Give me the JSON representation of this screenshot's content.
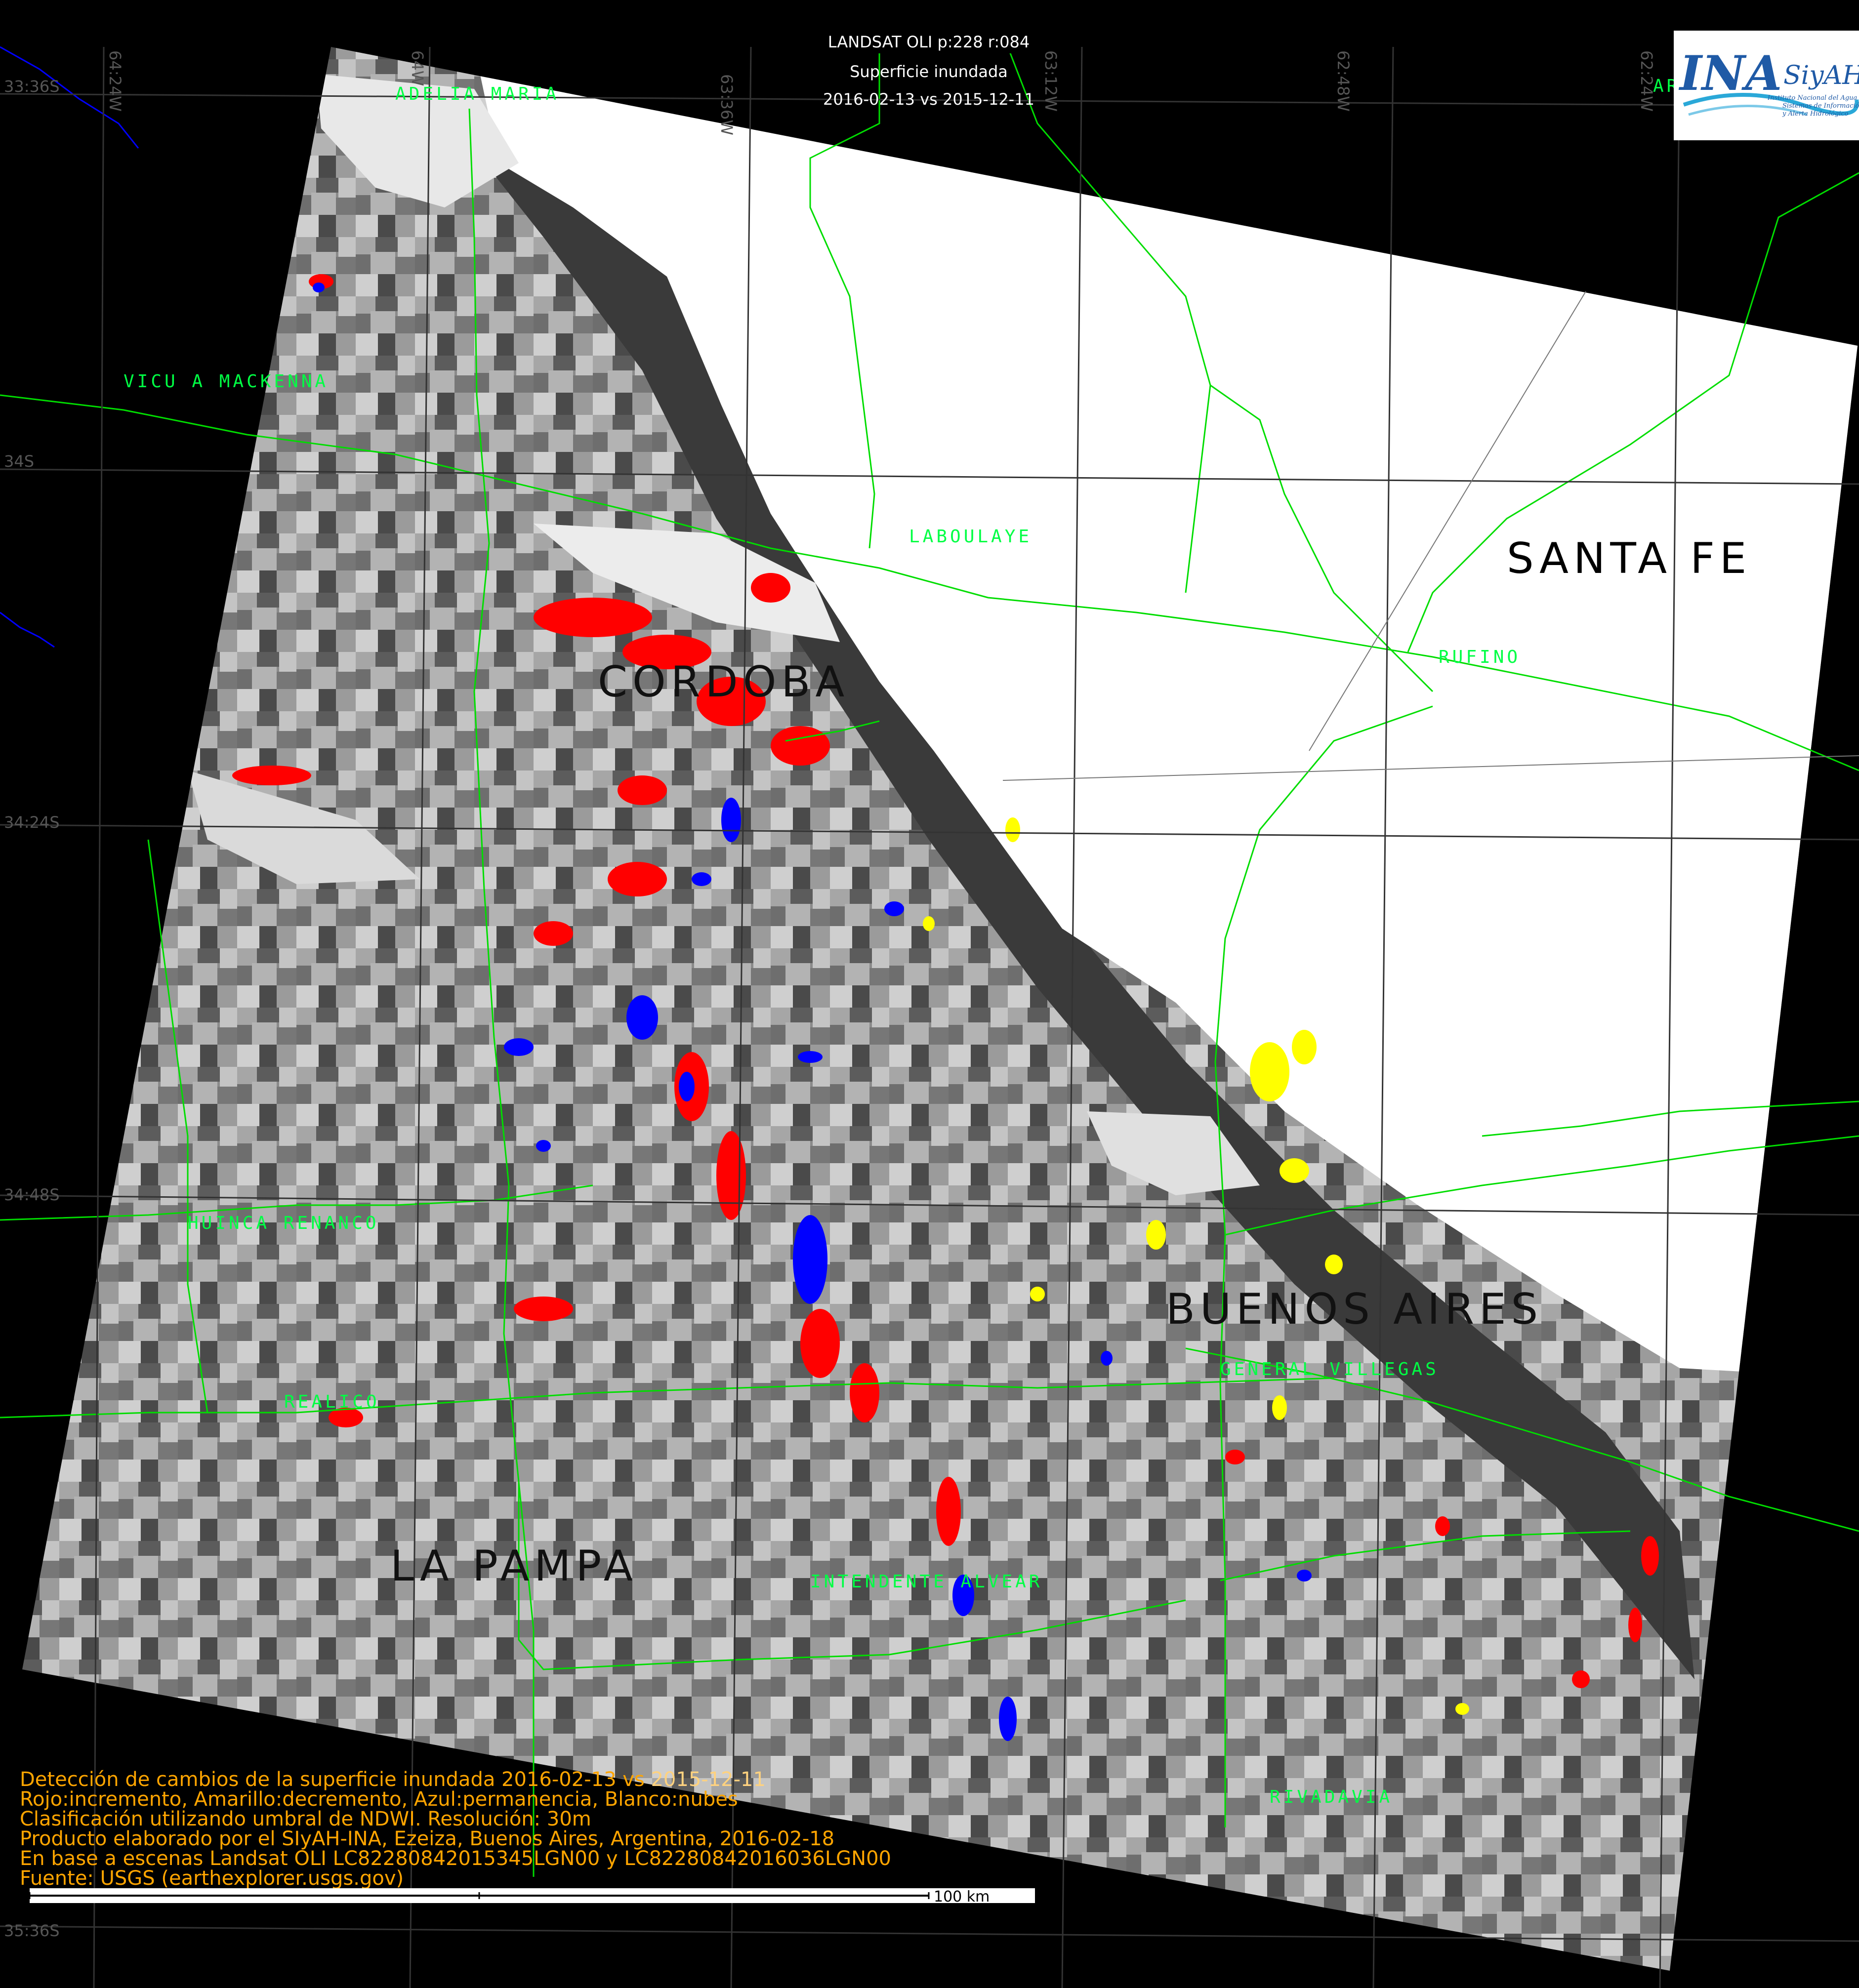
{
  "header": {
    "line1": "LANDSAT OLI p:228 r:084",
    "line2": "Superficie inundada",
    "line3": "2016-02-13 vs 2015-12-11"
  },
  "logo": {
    "brand": "INA",
    "brand2": "SiyAH",
    "sub1": "Instituto Nacional del Agua",
    "sub2": "Sistemas de Información",
    "sub3": "y Alerta Hidrológico"
  },
  "provinces": {
    "santa_fe": "SANTA FE",
    "cordoba": "CORDOBA",
    "buenos_aires": "BUENOS AIRES",
    "la_pampa": "LA PAMPA"
  },
  "departments": {
    "adelia_maria": "ADELIA MARIA",
    "vicuna": "VICU A MACKENNA",
    "laboulaye": "LABOULAYE",
    "rufino": "RUFINO",
    "huinca": "HUINCA RENANCO",
    "realico": "REALICO",
    "general_villegas": "GENERAL VILLEGAS",
    "intendente_alvear": "INTENDENTE ALVEAR",
    "rivadavia": "RIVADAVIA",
    "ar_partial": "AR"
  },
  "graticule": {
    "lat_33_36": "33:36S",
    "lat_34": "34S",
    "lat_34_24": "34:24S",
    "lat_34_48": "34:48S",
    "lat_35_36": "35:36S",
    "lon_64_24": "64:24W",
    "lon_64": "64W",
    "lon_63_36": "63:36W",
    "lon_63_12": "63:12W",
    "lon_62_48": "62:48W",
    "lon_62_24": "62:24W"
  },
  "legend": {
    "line1_a": "Detección de cambios de la superficie inundada 2016-02-13 vs ",
    "line1_b": "2015-12-11",
    "line2": " Rojo:incremento, Amarillo:decremento, Azul:permanencia, Blanco:nubes",
    "line3": "Clasificación utilizando umbral de NDWI. Resolución: 30m",
    "line4": "Producto elaborado por el SIyAH-INA, Ezeiza, Buenos Aires, Argentina, 2016-02-18",
    "line5": "En base a escenas Landsat OLI LC82280842015345LGN00 y LC82280842016036LGN00",
    "line6": "Fuente: USGS (earthexplorer.usgs.gov)"
  },
  "scale_label": "100 km",
  "colors": {
    "background": "#000000",
    "boundary_line": "#00dd00",
    "label_text": "#00ff44",
    "legend_text": "#ffa500",
    "increment": "#ff0000",
    "decrement": "#ffff00",
    "permanence": "#0000ff",
    "clouds": "#ffffff",
    "river": "#0000ff"
  },
  "classes": [
    "increment",
    "decrement",
    "permanence",
    "clouds"
  ]
}
